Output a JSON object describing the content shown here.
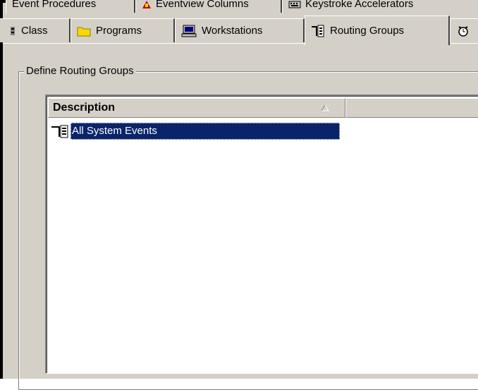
{
  "tabs_back": [
    {
      "label": "Event Procedures",
      "icon": "procedures-icon"
    },
    {
      "label": "Eventview Columns",
      "icon": "columns-icon"
    },
    {
      "label": "Keystroke Accelerators",
      "icon": "keyboard-icon"
    }
  ],
  "tabs_front": [
    {
      "label": "Class",
      "icon": "class-icon"
    },
    {
      "label": "Programs",
      "icon": "folder-icon"
    },
    {
      "label": "Workstations",
      "icon": "workstation-icon"
    },
    {
      "label": "Routing Groups",
      "icon": "routing-groups-icon",
      "active": true
    },
    {
      "label": "",
      "icon": "alarm-clock-icon"
    }
  ],
  "groupbox": {
    "label": "Define Routing Groups"
  },
  "list": {
    "columns": [
      {
        "label": "Description",
        "sort": "ascending"
      },
      {
        "label": ""
      }
    ],
    "rows": [
      {
        "description": "All System Events",
        "icon": "routing-groups-icon",
        "selected": true
      }
    ]
  },
  "colors": {
    "face": "#d4d0c8",
    "selection": "#0a246a"
  }
}
